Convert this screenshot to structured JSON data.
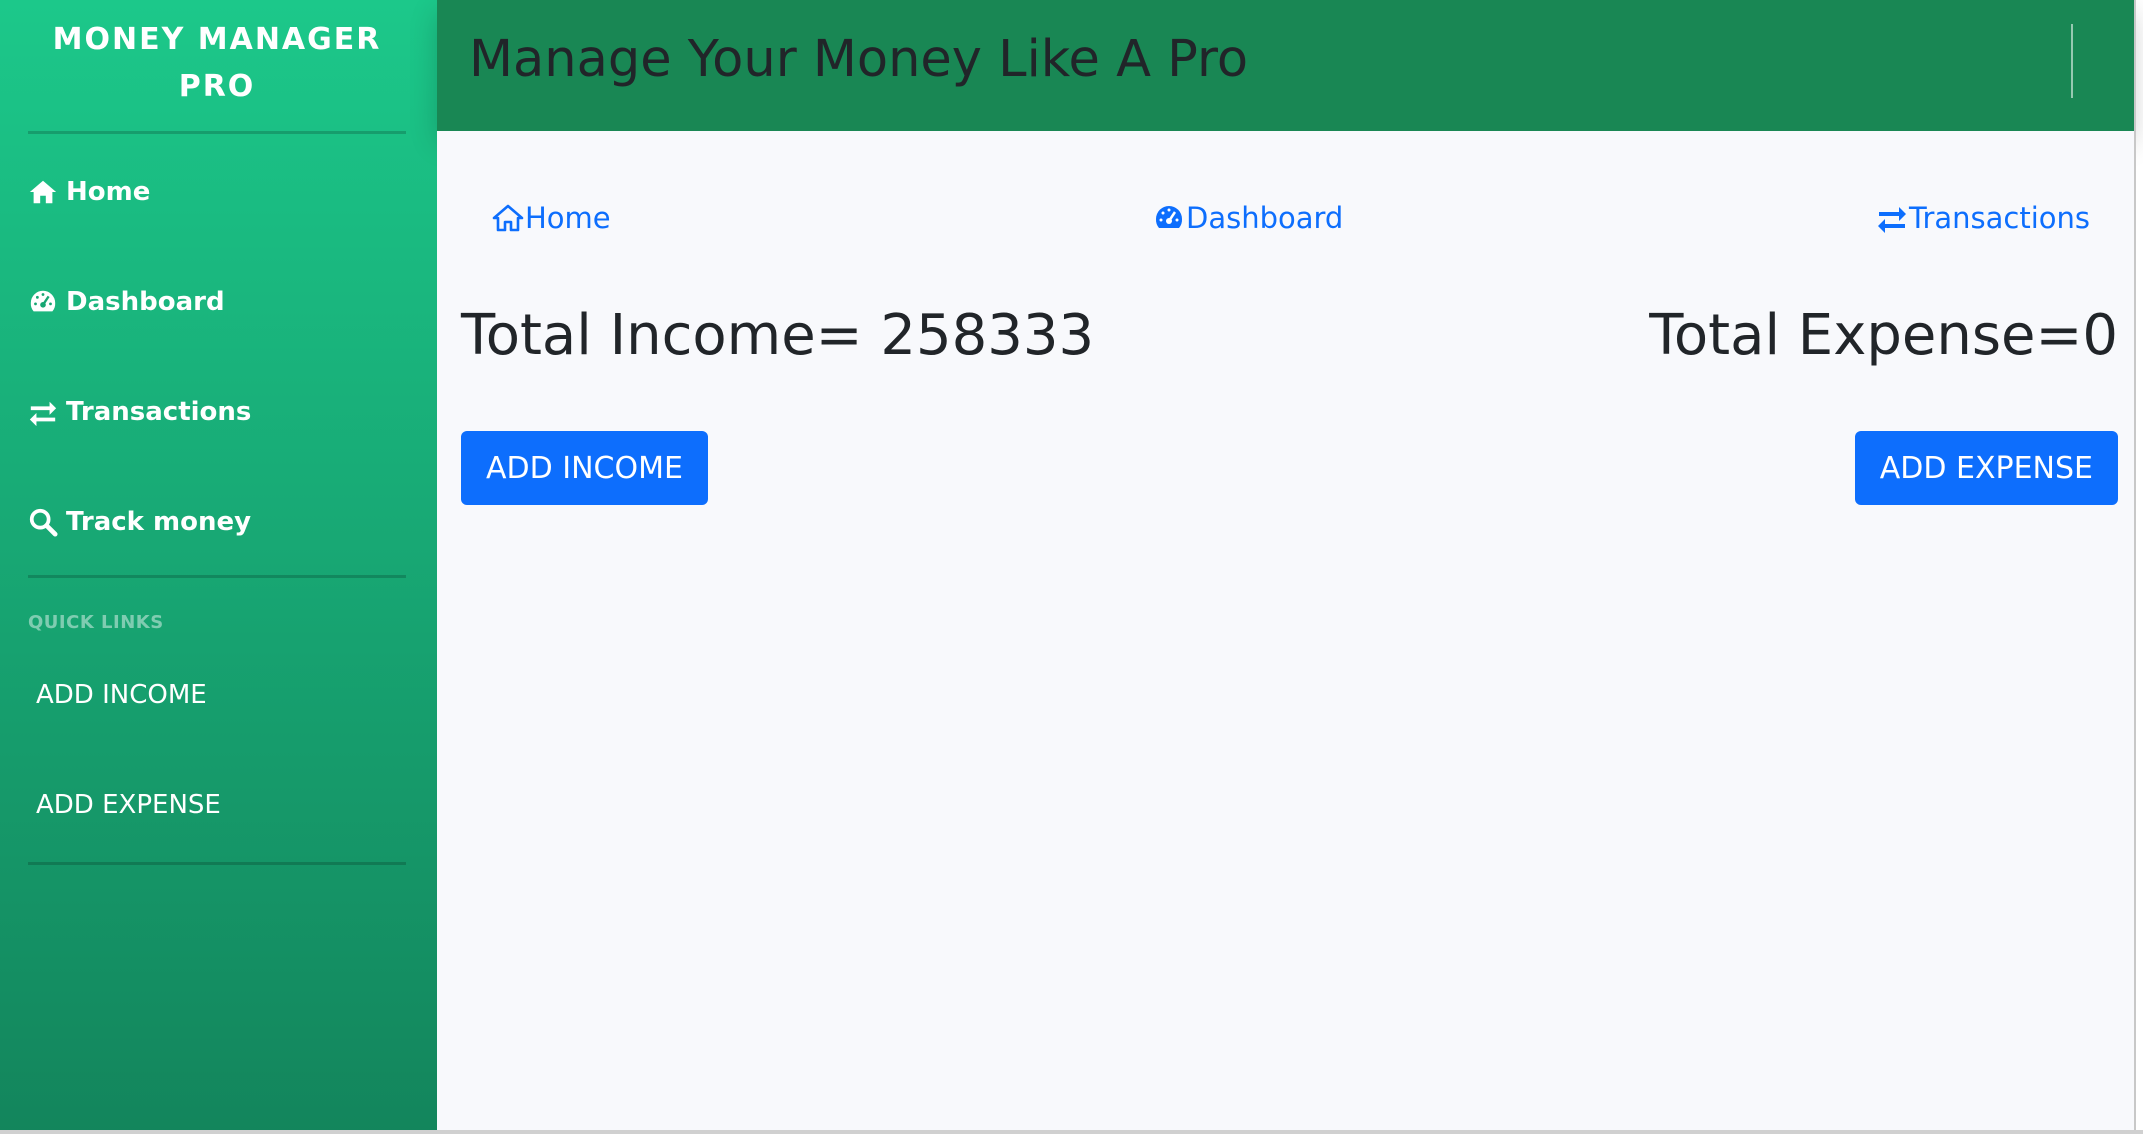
{
  "sidebar": {
    "brand": "MONEY MANAGER PRO",
    "nav": [
      {
        "label": "Home",
        "icon": "home-icon"
      },
      {
        "label": "Dashboard",
        "icon": "gauge-icon"
      },
      {
        "label": "Transactions",
        "icon": "exchange-icon"
      },
      {
        "label": "Track money",
        "icon": "search-icon"
      }
    ],
    "section_heading": "QUICK LINKS",
    "quick_links": [
      "ADD INCOME",
      "ADD EXPENSE"
    ]
  },
  "header": {
    "title": "Manage Your Money Like A Pro"
  },
  "main": {
    "links": [
      {
        "label": "Home",
        "icon": "home-icon"
      },
      {
        "label": "Dashboard",
        "icon": "gauge-icon"
      },
      {
        "label": "Transactions",
        "icon": "exchange-icon"
      }
    ],
    "total_income": "Total Income= 258333",
    "total_expense": "Total Expense=0",
    "add_income_button": "ADD INCOME",
    "add_expense_button": "ADD EXPENSE"
  },
  "colors": {
    "sidebar_top": "#1cc88a",
    "sidebar_bottom": "#13855c",
    "header_bg": "#198754",
    "primary": "#0d6efd",
    "text_dark": "#212529",
    "main_bg": "#f8f9fc"
  }
}
